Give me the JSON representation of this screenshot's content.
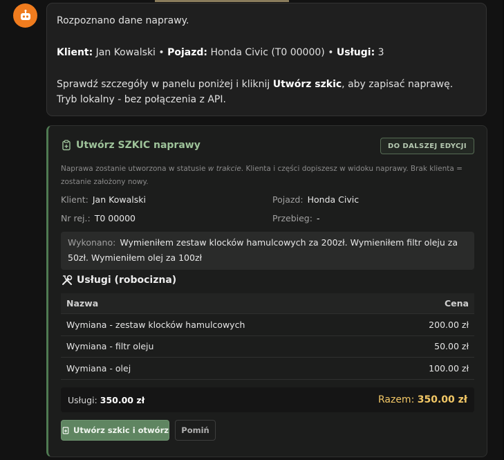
{
  "message": {
    "line1": "Rozpoznano dane naprawy.",
    "client_label": "Klient:",
    "client_value": "Jan Kowalski",
    "sep1": "•",
    "vehicle_label": "Pojazd:",
    "vehicle_value": "Honda Civic (T0 00000)",
    "sep2": "•",
    "services_label": "Usługi:",
    "services_value": "3",
    "line3_pre": "Sprawdź szczegóły w panelu poniżej i kliknij",
    "line3_bold": "Utwórz szkic",
    "line3_post": ", aby zapisać naprawę. Tryb lokalny - bez połączenia z API."
  },
  "card": {
    "title": "Utwórz SZKIC naprawy",
    "badge": "DO DALSZEJ EDYCJI",
    "desc_pre": "Naprawa zostanie utworzona w statusie",
    "desc_em": "w trakcie",
    "desc_post": ". Klienta i części dopiszesz w widoku naprawy. Brak klienta = zostanie założony nowy.",
    "fields": {
      "client_label": "Klient:",
      "client_value": "Jan Kowalski",
      "vehicle_label": "Pojazd:",
      "vehicle_value": "Honda Civic",
      "reg_label": "Nr rej.:",
      "reg_value": "T0 00000",
      "mileage_label": "Przebieg:",
      "mileage_value": "-"
    },
    "done_label": "Wykonano:",
    "done_value": "Wymieniłem zestaw klocków hamulcowych za 200zł. Wymieniłem filtr oleju za 50zł. Wymieniłem olej za 100zł",
    "services_title": "Usługi (robocizna)",
    "table": {
      "col_name": "Nazwa",
      "col_price": "Cena",
      "rows": [
        {
          "name": "Wymiana - zestaw klocków hamulcowych",
          "price": "200.00 zł"
        },
        {
          "name": "Wymiana - filtr oleju",
          "price": "50.00 zł"
        },
        {
          "name": "Wymiana - olej",
          "price": "100.00 zł"
        }
      ]
    },
    "summary_label": "Usługi:",
    "summary_value": "350.00 zł",
    "total_label": "Razem:",
    "total_value": "350.00 zł",
    "btn_create": "Utwórz szkic i otwórz",
    "btn_skip": "Pomiń"
  },
  "colors": {
    "accent_green": "#5f8561",
    "title_green": "#9ec39a",
    "total_gold": "#f2c766",
    "avatar_orange": "#f07c1e"
  }
}
